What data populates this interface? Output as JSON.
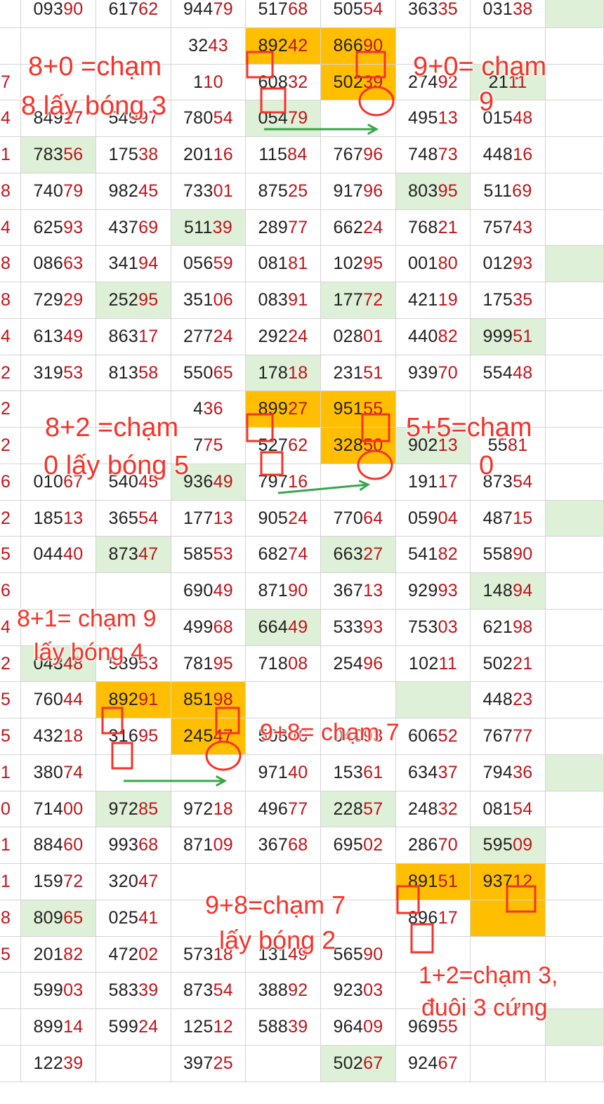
{
  "colors": {
    "head_digits": "#1f1f1f",
    "tail_digits": "#c0141a",
    "highlight": "#ffbf00",
    "green_cell": "#dff0d8",
    "annotation": "#f5332a",
    "arrow": "#3aa64a"
  },
  "lead_col": [
    "",
    "",
    "7",
    "4",
    "1",
    "8",
    "4",
    "8",
    "8",
    "4",
    "2",
    "2",
    "2",
    "6",
    "2",
    "5",
    "6",
    "4",
    "2",
    "5",
    "5",
    "1",
    "0",
    "1",
    "1",
    "8",
    "5",
    "",
    "",
    ""
  ],
  "rows": [
    [
      "09390",
      "61762",
      "94479",
      "51768",
      "50554",
      "36335",
      "03138",
      ""
    ],
    [
      "",
      "",
      "3243",
      "89242",
      "86690",
      "",
      "",
      ""
    ],
    [
      "",
      "",
      "110",
      "60832",
      "50239",
      "27492",
      "2111",
      ""
    ],
    [
      "84917",
      "54997",
      "78054",
      "05479",
      "",
      "49513",
      "01548",
      ""
    ],
    [
      "78356",
      "17538",
      "20116",
      "11584",
      "76796",
      "74873",
      "44816",
      ""
    ],
    [
      "74079",
      "98245",
      "73301",
      "87525",
      "91796",
      "80395",
      "51169",
      ""
    ],
    [
      "62593",
      "43769",
      "51139",
      "28977",
      "66224",
      "76821",
      "75743",
      ""
    ],
    [
      "08663",
      "34194",
      "05659",
      "08181",
      "10295",
      "00180",
      "01293",
      ""
    ],
    [
      "72929",
      "25295",
      "35106",
      "08391",
      "17772",
      "42119",
      "17535",
      ""
    ],
    [
      "61349",
      "86317",
      "27724",
      "29224",
      "02801",
      "44082",
      "99951",
      ""
    ],
    [
      "31953",
      "81358",
      "55065",
      "17818",
      "23151",
      "93970",
      "55448",
      ""
    ],
    [
      "",
      "",
      "436",
      "89927",
      "95155",
      "",
      "",
      ""
    ],
    [
      "",
      "",
      "775",
      "52762",
      "32850",
      "90213",
      "5581",
      ""
    ],
    [
      "01067",
      "54045",
      "93649",
      "79716",
      "",
      "19117",
      "87354",
      ""
    ],
    [
      "18513",
      "36554",
      "17713",
      "90524",
      "77064",
      "05904",
      "48715",
      ""
    ],
    [
      "04440",
      "87347",
      "58553",
      "68274",
      "66327",
      "54182",
      "55890",
      ""
    ],
    [
      "",
      "",
      "69049",
      "87190",
      "36713",
      "92993",
      "14894",
      ""
    ],
    [
      "",
      "",
      "49968",
      "66449",
      "53393",
      "75303",
      "62198",
      ""
    ],
    [
      "04348",
      "58953",
      "78195",
      "71808",
      "25496",
      "10211",
      "50221",
      ""
    ],
    [
      "76044",
      "89291",
      "85198",
      "",
      "",
      "",
      "44823",
      ""
    ],
    [
      "43218",
      "31695",
      "24547",
      "50846",
      "04093",
      "60652",
      "76777",
      ""
    ],
    [
      "38074",
      "",
      "",
      "97140",
      "15361",
      "63437",
      "79436",
      ""
    ],
    [
      "71400",
      "97285",
      "97218",
      "49677",
      "22857",
      "24832",
      "08154",
      ""
    ],
    [
      "88460",
      "99368",
      "87109",
      "36768",
      "69502",
      "28670",
      "59509",
      ""
    ],
    [
      "15972",
      "32047",
      "",
      "",
      "",
      "89151",
      "93712",
      ""
    ],
    [
      "80965",
      "02541",
      "",
      "",
      "",
      "89617",
      "",
      ""
    ],
    [
      "20182",
      "47202",
      "57318",
      "13149",
      "56590",
      "",
      "",
      ""
    ],
    [
      "59903",
      "58339",
      "87354",
      "38892",
      "92303",
      "",
      "",
      ""
    ],
    [
      "89914",
      "59924",
      "12512",
      "58839",
      "96409",
      "96955",
      "",
      ""
    ],
    [
      "12239",
      "",
      "39725",
      "",
      "50267",
      "92467",
      "",
      ""
    ]
  ],
  "annotations": [
    "8+0 =chạm",
    "8 lấy bóng 3",
    "9+0= chạm",
    "9",
    "8+2 =chạm",
    "0 lấy bóng 5",
    "5+5=chạm",
    "0",
    "8+1= chạm 9",
    "lấy bóng 4",
    "9+8= chạm 7",
    "9+8=chạm 7",
    "lấy bóng 2",
    "1+2=chạm 3,",
    "đuôi 3 cứng"
  ]
}
